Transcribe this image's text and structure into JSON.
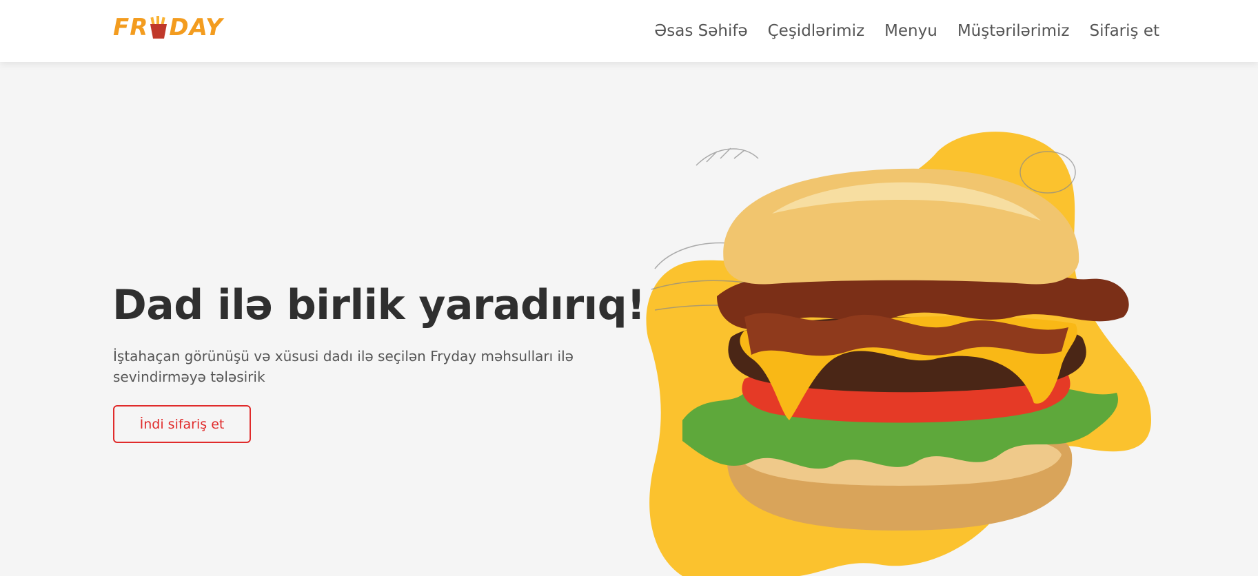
{
  "brand": {
    "logo_text": "FRYDAY",
    "colors": {
      "primary": "#f39c1f",
      "accent": "#e02b2b",
      "blob": "#fbc22e"
    }
  },
  "nav": {
    "items": [
      {
        "label": "Əsas Səhifə"
      },
      {
        "label": "Çeşidlərimiz"
      },
      {
        "label": "Menyu"
      },
      {
        "label": "Müştərilərimiz"
      },
      {
        "label": "Sifariş et"
      }
    ]
  },
  "hero": {
    "title": "Dad ilə birlik yaradırıq!",
    "subtitle": "İştahaçan görünüşü və xüsusi dadı ilə seçilən Fryday məhsulları ilə sevindirməyə tələsirik",
    "cta_label": "İndi sifariş et",
    "image_icon": "burger-illustration"
  }
}
